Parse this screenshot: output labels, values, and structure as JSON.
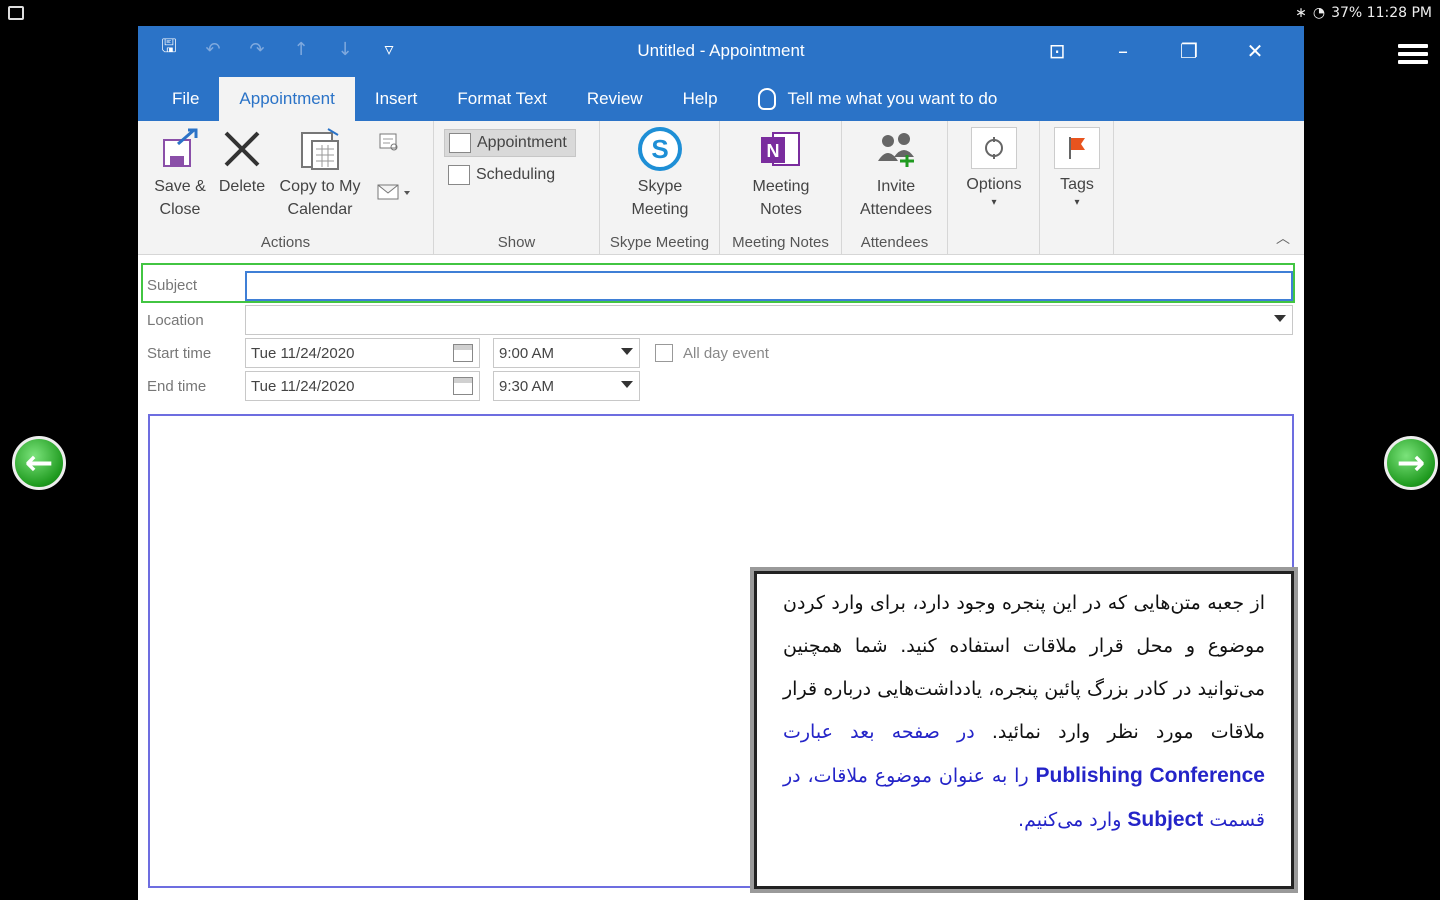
{
  "statusbar": {
    "right_text": "37% 11:28 PM"
  },
  "window": {
    "title": "Untitled  -  Appointment"
  },
  "tabs": [
    {
      "label": "File"
    },
    {
      "label": "Appointment"
    },
    {
      "label": "Insert"
    },
    {
      "label": "Format Text"
    },
    {
      "label": "Review"
    },
    {
      "label": "Help"
    }
  ],
  "tellme": "Tell me what you want to do",
  "ribbon": {
    "save_close": "Save & Close",
    "delete": "Delete",
    "copy_calendar": "Copy to My Calendar",
    "actions_label": "Actions",
    "appointment": "Appointment",
    "scheduling": "Scheduling",
    "show_label": "Show",
    "skype_meeting": "Skype Meeting",
    "skype_group": "Skype Meeting",
    "meeting_notes": "Meeting Notes",
    "meeting_notes_group": "Meeting Notes",
    "invite_attendees": "Invite Attendees",
    "attendees_label": "Attendees",
    "options": "Options",
    "tags": "Tags"
  },
  "form": {
    "subject_label": "Subject",
    "subject_value": "",
    "location_label": "Location",
    "location_value": "",
    "start_label": "Start time",
    "start_date": "Tue 11/24/2020",
    "start_time": "9:00 AM",
    "end_label": "End time",
    "end_date": "Tue 11/24/2020",
    "end_time": "9:30 AM",
    "allday_label": "All day event"
  },
  "note": {
    "text_black": "از جعبه متن‌هایی که در این پنجره وجود دارد، برای وارد کردن موضوع و محل قرار ملاقات استفاده کنید. شما همچنین می‌توانید در کادر بزرگ پائین پنجره، یادداشت‌هایی درباره قرار ملاقات مورد نظر وارد نمائید.",
    "text_blue_1": " در صفحه بعد عبارت ",
    "latin_1": "Publishing Conference",
    "text_blue_2": " را به عنوان موضوع ملاقات، در قسمت ",
    "latin_2": "Subject",
    "text_blue_3": " وارد می‌کنیم."
  }
}
